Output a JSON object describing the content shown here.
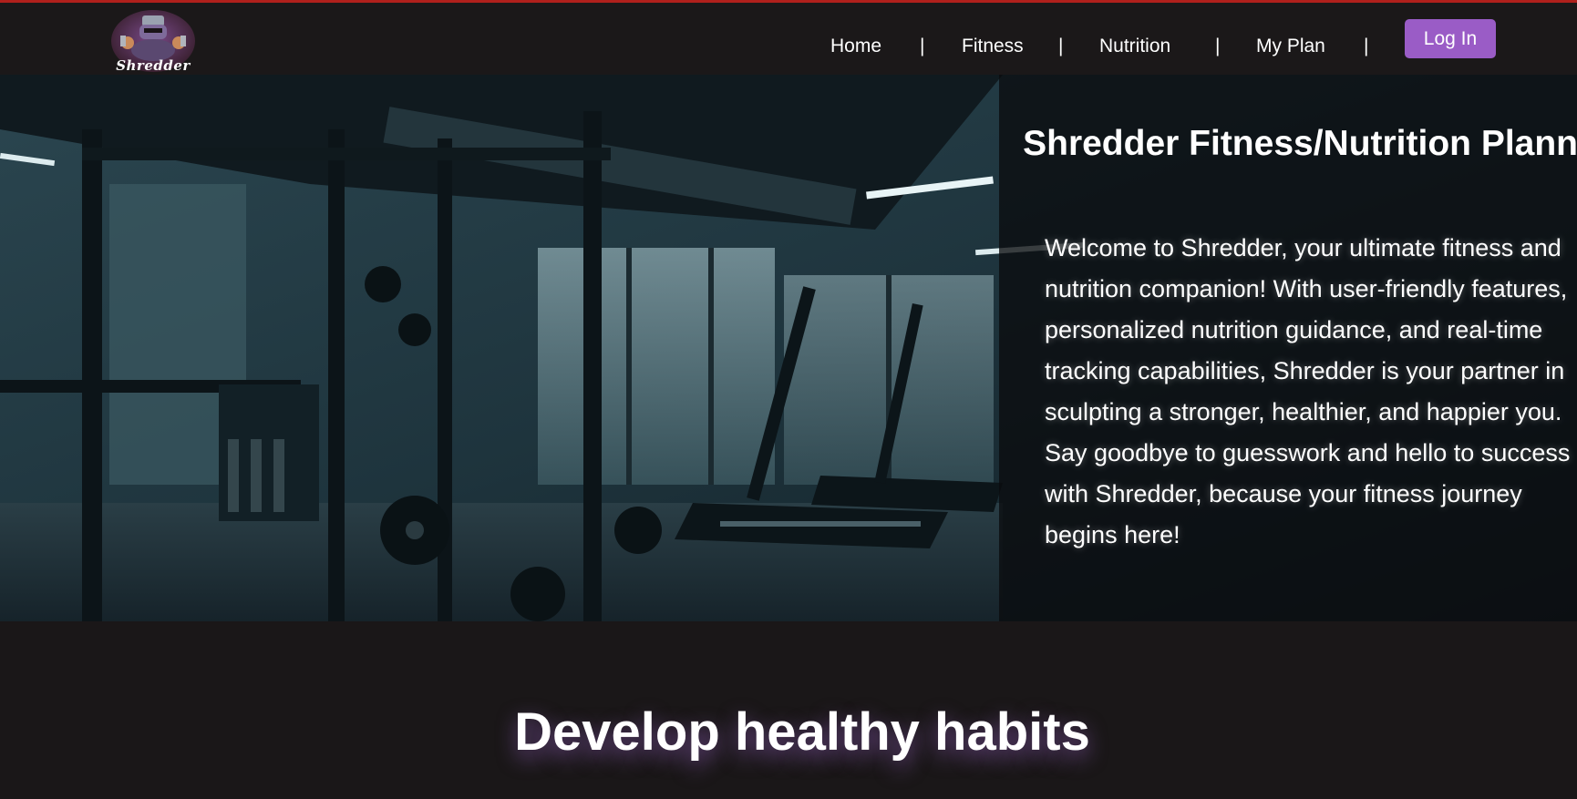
{
  "brand": {
    "logo_text": "Shredder"
  },
  "nav": {
    "items": [
      {
        "label": "Home"
      },
      {
        "label": "Fitness"
      },
      {
        "label": "Nutrition"
      },
      {
        "label": "My Plan"
      }
    ],
    "separator": "|",
    "login_label": "Log In"
  },
  "hero": {
    "title": "Shredder Fitness/Nutrition Planner",
    "text": "Welcome to Shredder, your ultimate fitness and nutrition companion! With user-friendly features, personalized nutrition guidance, and real-time tracking capabilities, Shredder is your partner in sculpting a stronger, healthier, and happier you. Say goodbye to guesswork and hello to success with Shredder, because your fitness journey begins here!"
  },
  "section": {
    "title": "Develop healthy habits"
  },
  "colors": {
    "background": "#1a1718",
    "accent": "#9a5cc6",
    "top_border": "#b0201c"
  }
}
